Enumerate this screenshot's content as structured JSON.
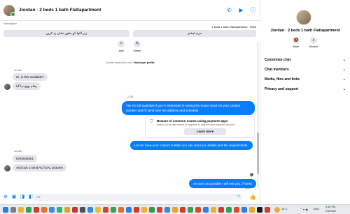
{
  "chat": {
    "title": "Jiordan · 2 beds 1 bath Flat/apartment",
    "marketplace_label": "Marketplace",
    "listing_title": "2 beds 1 bath Flat/apartment · $750",
    "action_right": "مزید اپشنز",
    "action_left": "زیر التوا کے بطور نشان زد کریں",
    "top_actions": [
      {
        "icon": "add-icon",
        "glyph": "+",
        "label": "Add"
      },
      {
        "icon": "edit-icon",
        "glyph": "✎",
        "label": "Name"
      }
    ],
    "started_text": "Jiordan started this chat.",
    "view_profile": "View buyer profile",
    "messages": {
      "sender1": "Jiordan",
      "in1": "Hi, is this available?",
      "in2": "پیغام بھیج دیا گیا",
      "time_divider": "21:28",
      "out1_line1": "Yes it's still available if you're interested in seeing the house send me your contact",
      "out1_line2": "number and I'll send over the address and schedule.",
      "card_title": "Beware of common scams using payment apps",
      "card_sub": "Watch out for fake emails or requests to upgrade your payment account.",
      "card_button": "Learn more",
      "out2": "Let me have your contact number so i can send you details and the requirements.",
      "sender2": "Jiordan",
      "in3": "6782649301",
      "in4": "And can u send ACTUAL pictures",
      "out3": "As soon as possible I will text you..Thanks",
      "sent_status": "Sent"
    },
    "composer": {
      "placeholder": "Aa"
    }
  },
  "info_panel": {
    "name": "Jiordan · 2 beds 1 bath Flat/apartment",
    "actions": [
      {
        "icon": "bell-mute-icon",
        "glyph": "🔕",
        "label": "Mute"
      },
      {
        "icon": "search-icon",
        "glyph": "⌕",
        "label": "Search"
      }
    ],
    "menu": [
      {
        "label": "Customise chat"
      },
      {
        "label": "Chat members"
      },
      {
        "label": "Media, files and links"
      },
      {
        "label": "Privacy and support"
      }
    ]
  },
  "taskbar": {
    "weather": "15°C",
    "time": "9:40 PM",
    "date": "2/3/2025",
    "lang": "ENG"
  },
  "colors": {
    "accent": "#0a7cff",
    "bubble_in": "#e4e6eb",
    "secondary_text": "#65676b"
  }
}
